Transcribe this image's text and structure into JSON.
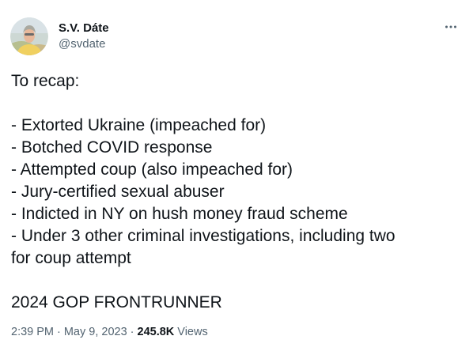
{
  "author": {
    "display_name": "S.V. Dáte",
    "handle": "@svdate",
    "avatar_icon": "profile-photo-icon"
  },
  "more_icon": "more-horizontal-icon",
  "tweet": {
    "lines": [
      "To recap:",
      "",
      "- Extorted Ukraine (impeached for)",
      "- Botched COVID response",
      "- Attempted coup (also impeached for)",
      "- Jury-certified sexual abuser",
      "- Indicted in NY on hush money fraud scheme",
      "- Under 3 other criminal investigations, including two",
      "for coup attempt",
      "",
      "2024 GOP FRONTRUNNER"
    ]
  },
  "meta": {
    "time": "2:39 PM",
    "separator": "·",
    "date": "May 9, 2023",
    "views_count": "245.8K",
    "views_label": "Views"
  },
  "colors": {
    "text_primary": "#0f1419",
    "text_secondary": "#536471",
    "background": "#ffffff"
  }
}
